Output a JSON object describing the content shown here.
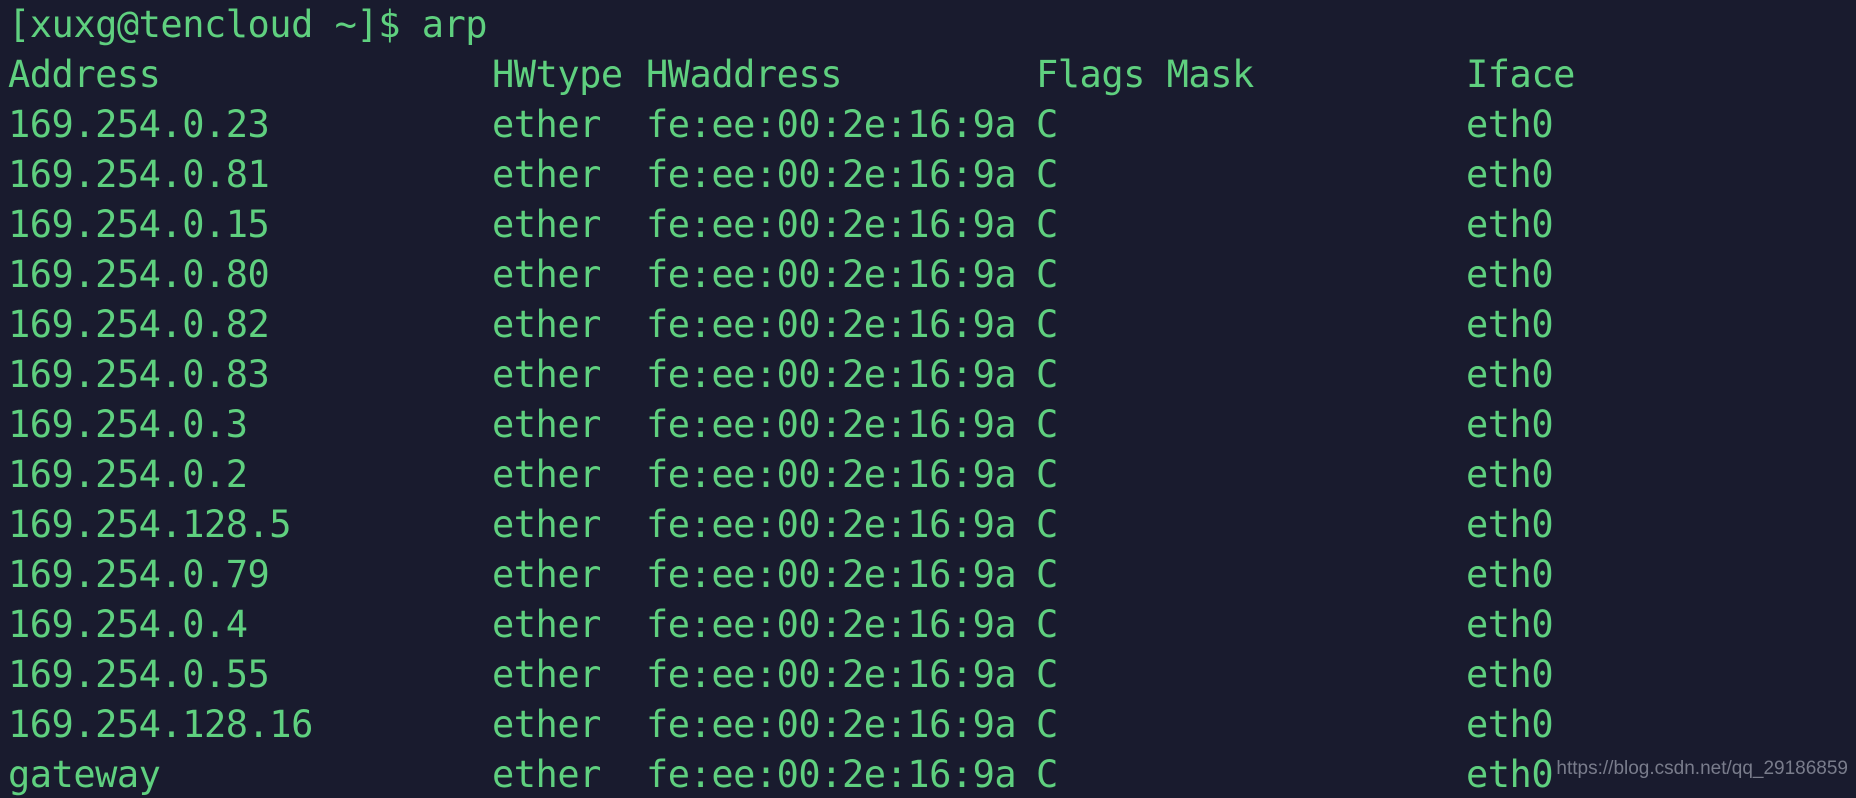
{
  "terminal": {
    "background_color": "#191b2e",
    "text_color": "#5fd07f",
    "prompt_line": "[xuxg@tencloud ~]$ arp"
  },
  "table": {
    "headers": {
      "address": "Address",
      "hwtype": "HWtype",
      "hwaddress": "HWaddress",
      "flags_mask": "Flags Mask",
      "iface": "Iface"
    },
    "rows": [
      {
        "address": "169.254.0.23",
        "hwtype": "ether",
        "hwaddress": "fe:ee:00:2e:16:9a",
        "flags": "C",
        "iface": "eth0"
      },
      {
        "address": "169.254.0.81",
        "hwtype": "ether",
        "hwaddress": "fe:ee:00:2e:16:9a",
        "flags": "C",
        "iface": "eth0"
      },
      {
        "address": "169.254.0.15",
        "hwtype": "ether",
        "hwaddress": "fe:ee:00:2e:16:9a",
        "flags": "C",
        "iface": "eth0"
      },
      {
        "address": "169.254.0.80",
        "hwtype": "ether",
        "hwaddress": "fe:ee:00:2e:16:9a",
        "flags": "C",
        "iface": "eth0"
      },
      {
        "address": "169.254.0.82",
        "hwtype": "ether",
        "hwaddress": "fe:ee:00:2e:16:9a",
        "flags": "C",
        "iface": "eth0"
      },
      {
        "address": "169.254.0.83",
        "hwtype": "ether",
        "hwaddress": "fe:ee:00:2e:16:9a",
        "flags": "C",
        "iface": "eth0"
      },
      {
        "address": "169.254.0.3",
        "hwtype": "ether",
        "hwaddress": "fe:ee:00:2e:16:9a",
        "flags": "C",
        "iface": "eth0"
      },
      {
        "address": "169.254.0.2",
        "hwtype": "ether",
        "hwaddress": "fe:ee:00:2e:16:9a",
        "flags": "C",
        "iface": "eth0"
      },
      {
        "address": "169.254.128.5",
        "hwtype": "ether",
        "hwaddress": "fe:ee:00:2e:16:9a",
        "flags": "C",
        "iface": "eth0"
      },
      {
        "address": "169.254.0.79",
        "hwtype": "ether",
        "hwaddress": "fe:ee:00:2e:16:9a",
        "flags": "C",
        "iface": "eth0"
      },
      {
        "address": "169.254.0.4",
        "hwtype": "ether",
        "hwaddress": "fe:ee:00:2e:16:9a",
        "flags": "C",
        "iface": "eth0"
      },
      {
        "address": "169.254.0.55",
        "hwtype": "ether",
        "hwaddress": "fe:ee:00:2e:16:9a",
        "flags": "C",
        "iface": "eth0"
      },
      {
        "address": "169.254.128.16",
        "hwtype": "ether",
        "hwaddress": "fe:ee:00:2e:16:9a",
        "flags": "C",
        "iface": "eth0"
      },
      {
        "address": "gateway",
        "hwtype": "ether",
        "hwaddress": "fe:ee:00:2e:16:9a",
        "flags": "C",
        "iface": "eth0"
      }
    ]
  },
  "watermark": {
    "text": "https://blog.csdn.net/qq_29186859"
  }
}
